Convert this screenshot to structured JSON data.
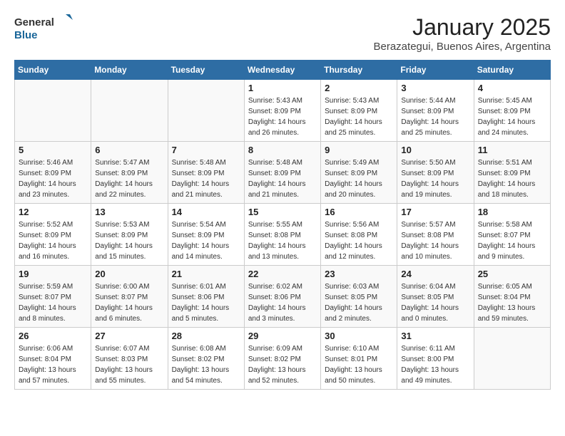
{
  "header": {
    "logo_general": "General",
    "logo_blue": "Blue",
    "month": "January 2025",
    "location": "Berazategui, Buenos Aires, Argentina"
  },
  "weekdays": [
    "Sunday",
    "Monday",
    "Tuesday",
    "Wednesday",
    "Thursday",
    "Friday",
    "Saturday"
  ],
  "weeks": [
    [
      {
        "day": "",
        "empty": true
      },
      {
        "day": "",
        "empty": true
      },
      {
        "day": "",
        "empty": true
      },
      {
        "day": "1",
        "sunrise": "5:43 AM",
        "sunset": "8:09 PM",
        "daylight": "14 hours and 26 minutes."
      },
      {
        "day": "2",
        "sunrise": "5:43 AM",
        "sunset": "8:09 PM",
        "daylight": "14 hours and 25 minutes."
      },
      {
        "day": "3",
        "sunrise": "5:44 AM",
        "sunset": "8:09 PM",
        "daylight": "14 hours and 25 minutes."
      },
      {
        "day": "4",
        "sunrise": "5:45 AM",
        "sunset": "8:09 PM",
        "daylight": "14 hours and 24 minutes."
      }
    ],
    [
      {
        "day": "5",
        "sunrise": "5:46 AM",
        "sunset": "8:09 PM",
        "daylight": "14 hours and 23 minutes."
      },
      {
        "day": "6",
        "sunrise": "5:47 AM",
        "sunset": "8:09 PM",
        "daylight": "14 hours and 22 minutes."
      },
      {
        "day": "7",
        "sunrise": "5:48 AM",
        "sunset": "8:09 PM",
        "daylight": "14 hours and 21 minutes."
      },
      {
        "day": "8",
        "sunrise": "5:48 AM",
        "sunset": "8:09 PM",
        "daylight": "14 hours and 21 minutes."
      },
      {
        "day": "9",
        "sunrise": "5:49 AM",
        "sunset": "8:09 PM",
        "daylight": "14 hours and 20 minutes."
      },
      {
        "day": "10",
        "sunrise": "5:50 AM",
        "sunset": "8:09 PM",
        "daylight": "14 hours and 19 minutes."
      },
      {
        "day": "11",
        "sunrise": "5:51 AM",
        "sunset": "8:09 PM",
        "daylight": "14 hours and 18 minutes."
      }
    ],
    [
      {
        "day": "12",
        "sunrise": "5:52 AM",
        "sunset": "8:09 PM",
        "daylight": "14 hours and 16 minutes."
      },
      {
        "day": "13",
        "sunrise": "5:53 AM",
        "sunset": "8:09 PM",
        "daylight": "14 hours and 15 minutes."
      },
      {
        "day": "14",
        "sunrise": "5:54 AM",
        "sunset": "8:09 PM",
        "daylight": "14 hours and 14 minutes."
      },
      {
        "day": "15",
        "sunrise": "5:55 AM",
        "sunset": "8:08 PM",
        "daylight": "14 hours and 13 minutes."
      },
      {
        "day": "16",
        "sunrise": "5:56 AM",
        "sunset": "8:08 PM",
        "daylight": "14 hours and 12 minutes."
      },
      {
        "day": "17",
        "sunrise": "5:57 AM",
        "sunset": "8:08 PM",
        "daylight": "14 hours and 10 minutes."
      },
      {
        "day": "18",
        "sunrise": "5:58 AM",
        "sunset": "8:07 PM",
        "daylight": "14 hours and 9 minutes."
      }
    ],
    [
      {
        "day": "19",
        "sunrise": "5:59 AM",
        "sunset": "8:07 PM",
        "daylight": "14 hours and 8 minutes."
      },
      {
        "day": "20",
        "sunrise": "6:00 AM",
        "sunset": "8:07 PM",
        "daylight": "14 hours and 6 minutes."
      },
      {
        "day": "21",
        "sunrise": "6:01 AM",
        "sunset": "8:06 PM",
        "daylight": "14 hours and 5 minutes."
      },
      {
        "day": "22",
        "sunrise": "6:02 AM",
        "sunset": "8:06 PM",
        "daylight": "14 hours and 3 minutes."
      },
      {
        "day": "23",
        "sunrise": "6:03 AM",
        "sunset": "8:05 PM",
        "daylight": "14 hours and 2 minutes."
      },
      {
        "day": "24",
        "sunrise": "6:04 AM",
        "sunset": "8:05 PM",
        "daylight": "14 hours and 0 minutes."
      },
      {
        "day": "25",
        "sunrise": "6:05 AM",
        "sunset": "8:04 PM",
        "daylight": "13 hours and 59 minutes."
      }
    ],
    [
      {
        "day": "26",
        "sunrise": "6:06 AM",
        "sunset": "8:04 PM",
        "daylight": "13 hours and 57 minutes."
      },
      {
        "day": "27",
        "sunrise": "6:07 AM",
        "sunset": "8:03 PM",
        "daylight": "13 hours and 55 minutes."
      },
      {
        "day": "28",
        "sunrise": "6:08 AM",
        "sunset": "8:02 PM",
        "daylight": "13 hours and 54 minutes."
      },
      {
        "day": "29",
        "sunrise": "6:09 AM",
        "sunset": "8:02 PM",
        "daylight": "13 hours and 52 minutes."
      },
      {
        "day": "30",
        "sunrise": "6:10 AM",
        "sunset": "8:01 PM",
        "daylight": "13 hours and 50 minutes."
      },
      {
        "day": "31",
        "sunrise": "6:11 AM",
        "sunset": "8:00 PM",
        "daylight": "13 hours and 49 minutes."
      },
      {
        "day": "",
        "empty": true
      }
    ]
  ]
}
